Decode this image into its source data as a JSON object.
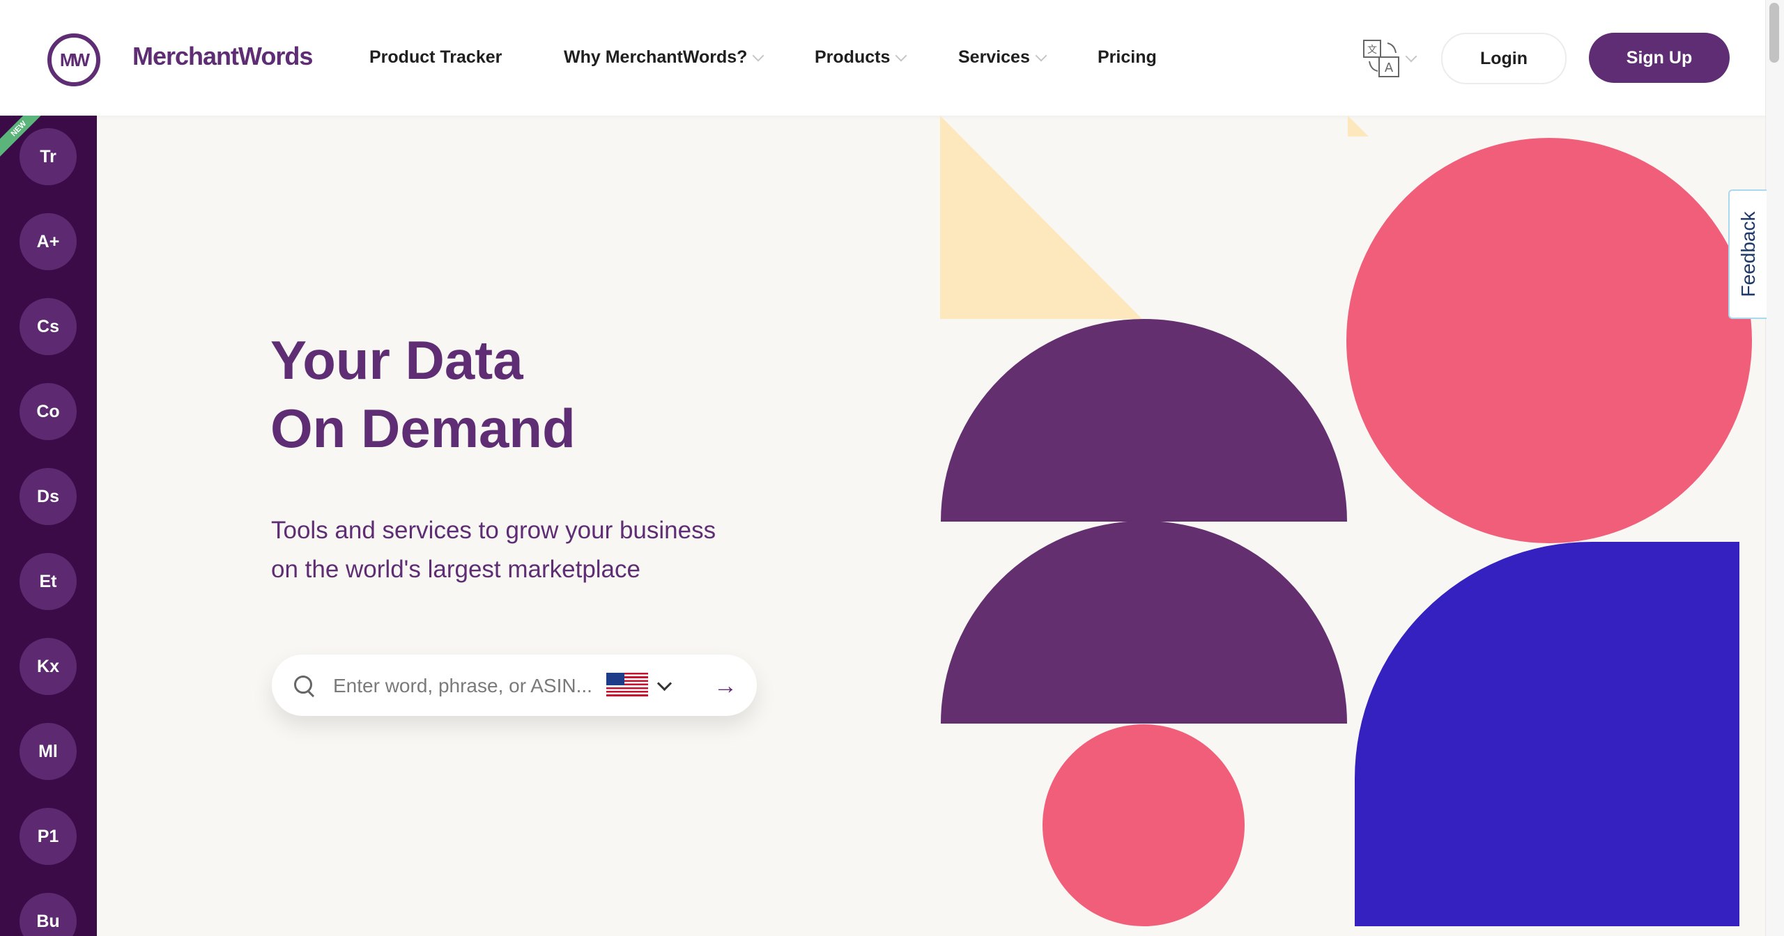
{
  "brand": {
    "name": "MerchantWords",
    "logo_initials": "MW"
  },
  "nav": {
    "items": [
      {
        "label": "Product Tracker",
        "has_dropdown": false
      },
      {
        "label": "Why MerchantWords?",
        "has_dropdown": true
      },
      {
        "label": "Products",
        "has_dropdown": true
      },
      {
        "label": "Services",
        "has_dropdown": true
      },
      {
        "label": "Pricing",
        "has_dropdown": false
      }
    ],
    "language_icon": "translate-icon",
    "login_label": "Login",
    "signup_label": "Sign Up"
  },
  "sidebar": {
    "ribbon": "NEW",
    "tools": [
      "Tr",
      "A+",
      "Cs",
      "Co",
      "Ds",
      "Et",
      "Kx",
      "Ml",
      "P1",
      "Bu"
    ]
  },
  "hero": {
    "title_line1": "Your Data",
    "title_line2": "On Demand",
    "subtitle_line1": "Tools and services to grow your business",
    "subtitle_line2": "on the world's largest marketplace"
  },
  "search": {
    "placeholder": "Enter word, phrase, or ASIN...",
    "value": "",
    "country_flag": "us-flag-icon"
  },
  "feedback": {
    "label": "Feedback"
  },
  "colors": {
    "brand_purple": "#5e2d73",
    "sidebar_bg": "#3a0b47",
    "coral": "#f05e7a",
    "blue": "#3520c0",
    "cream": "#fde8bd"
  }
}
